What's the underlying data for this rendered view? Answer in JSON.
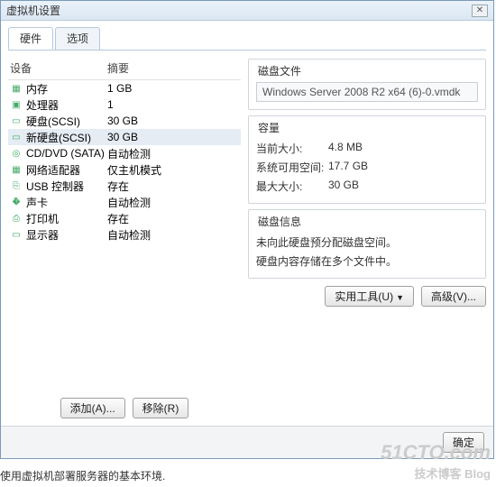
{
  "window": {
    "title": "虚拟机设置"
  },
  "tabs": {
    "hardware": "硬件",
    "options": "选项"
  },
  "list": {
    "head_device": "设备",
    "head_summary": "摘要",
    "items": [
      {
        "icon": "▦",
        "name": "内存",
        "summary": "1 GB"
      },
      {
        "icon": "▣",
        "name": "处理器",
        "summary": "1"
      },
      {
        "icon": "▭",
        "name": "硬盘(SCSI)",
        "summary": "30 GB"
      },
      {
        "icon": "▭",
        "name": "新硬盘(SCSI)",
        "summary": "30 GB",
        "selected": true
      },
      {
        "icon": "◎",
        "name": "CD/DVD (SATA)",
        "summary": "自动检测"
      },
      {
        "icon": "▦",
        "name": "网络适配器",
        "summary": "仅主机模式"
      },
      {
        "icon": "⎘",
        "name": "USB 控制器",
        "summary": "存在"
      },
      {
        "icon": "�ާ",
        "name": "声卡",
        "summary": "自动检测"
      },
      {
        "icon": "⎙",
        "name": "打印机",
        "summary": "存在"
      },
      {
        "icon": "▭",
        "name": "显示器",
        "summary": "自动检测"
      }
    ],
    "add_btn": "添加(A)...",
    "remove_btn": "移除(R)"
  },
  "disk_file": {
    "title": "磁盘文件",
    "value": "Windows Server 2008 R2 x64 (6)-0.vmdk"
  },
  "capacity": {
    "title": "容量",
    "current_k": "当前大小:",
    "current_v": "4.8 MB",
    "free_k": "系统可用空间:",
    "free_v": "17.7 GB",
    "max_k": "最大大小:",
    "max_v": "30 GB"
  },
  "disk_info": {
    "title": "磁盘信息",
    "line1": "未向此硬盘预分配磁盘空间。",
    "line2": "硬盘内容存储在多个文件中。"
  },
  "right_btns": {
    "util": "实用工具(U)",
    "adv": "高级(V)..."
  },
  "footer": {
    "ok": "确定"
  },
  "caption": "使用虚拟机部署服务器的基本环境.",
  "watermark": {
    "big": "51CTO.com",
    "small": "技术博客  Blog"
  }
}
